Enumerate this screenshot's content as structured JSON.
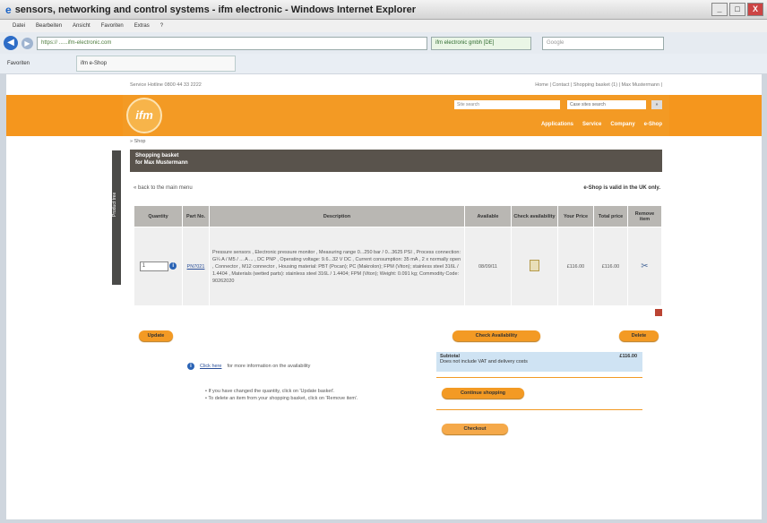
{
  "window": {
    "title": "sensors, networking and control systems - ifm electronic - Windows Internet Explorer",
    "buttons": [
      "_",
      "□",
      "X"
    ]
  },
  "menubar": [
    "Datei",
    "Bearbeiten",
    "Ansicht",
    "Favoriten",
    "Extras",
    "?"
  ],
  "address": {
    "url": "https:// ......ifm-electronic.com",
    "cert": "ifm electronic gmbh [DE]",
    "search_placeholder": "Google"
  },
  "favbar": {
    "favorites": "Favoriten",
    "tab": "ifm e-Shop"
  },
  "site": {
    "hotline": "Service Hotline 0800 44 33 2222",
    "toplinks": "Home | Contact | Shopping basket (1) | Max Mustermann | ",
    "logo": "ifm",
    "search_placeholder": "Site search",
    "search_scope": "Case sites search",
    "go": "»",
    "nav": [
      "Applications",
      "Service",
      "Company",
      "e-Shop"
    ],
    "breadcrumb": "» Shop",
    "side_tab": "Product tree"
  },
  "basket": {
    "title": "Shopping basket",
    "subtitle": "for Max Mustermann",
    "back_link": "« back to the main menu",
    "valid_note": "e-Shop is valid in the UK only.",
    "columns": [
      "Quantity",
      "Part No.",
      "Description",
      "Available",
      "Check availability",
      "Your Price",
      "Total price",
      "Remove item"
    ],
    "rows": [
      {
        "quantity": "1",
        "part_no": "PN7021",
        "description": "Pressure sensors , Electronic pressure monitor , Measuring range 0...250 bar / 0...3625 PSI , Process connection: G¼ A / M5 / ... A ... , DC PNP , Operating voltage: 9.6...32 V DC , Current consumption: 35 mA , 2 x normally open , Connector , M12 connector , Housing material: PBT (Pocan); PC (Makrolon); FPM (Viton); stainless steel 316L / 1.4404 , Materials (wetted parts): stainless steel 316L / 1.4404; FPM (Viton); Weight: 0.091 kg; Commodity Code: 90262020",
        "available": "08/09/11",
        "your_price": "£116.00",
        "total_price": "£116.00"
      }
    ],
    "update_button": "Update",
    "check_availability_button": "Check Availability",
    "delete_button": "Delete",
    "availability_info_link": "Click here",
    "availability_info_text": "for more information on the availability",
    "hints": [
      "If you have changed the quantity, click on 'Update basket'.",
      "To delete an item from your shopping basket, click on 'Remove item'."
    ],
    "subtotal_label": "Subtotal",
    "subtotal_note": "Does not include VAT and delivery costs",
    "subtotal_value": "£116.00",
    "continue_button": "Continue shopping",
    "checkout_button": "Checkout"
  }
}
